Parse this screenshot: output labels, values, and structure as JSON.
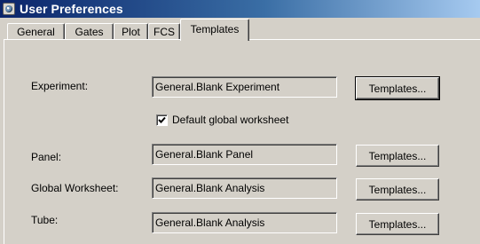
{
  "window": {
    "title": "User Preferences",
    "icon": "app-icon"
  },
  "tabs": [
    {
      "label": "General",
      "active": false
    },
    {
      "label": "Gates",
      "active": false
    },
    {
      "label": "Plot",
      "active": false
    },
    {
      "label": "FCS",
      "active": false
    },
    {
      "label": "Templates",
      "active": true
    }
  ],
  "experiment": {
    "label": "Experiment:",
    "value": "General.Blank Experiment",
    "button": "Templates..."
  },
  "default_global_worksheet": {
    "label": "Default global worksheet",
    "checked": true
  },
  "panel": {
    "label": "Panel:",
    "value": "General.Blank Panel",
    "button": "Templates..."
  },
  "global_worksheet": {
    "label": "Global Worksheet:",
    "value": "General.Blank Analysis",
    "button": "Templates..."
  },
  "tube": {
    "label": "Tube:",
    "value": "General.Blank Analysis",
    "button": "Templates..."
  },
  "colors": {
    "titlebar_start": "#0a246a",
    "titlebar_end": "#a6caf0",
    "face": "#d4d0c8"
  }
}
